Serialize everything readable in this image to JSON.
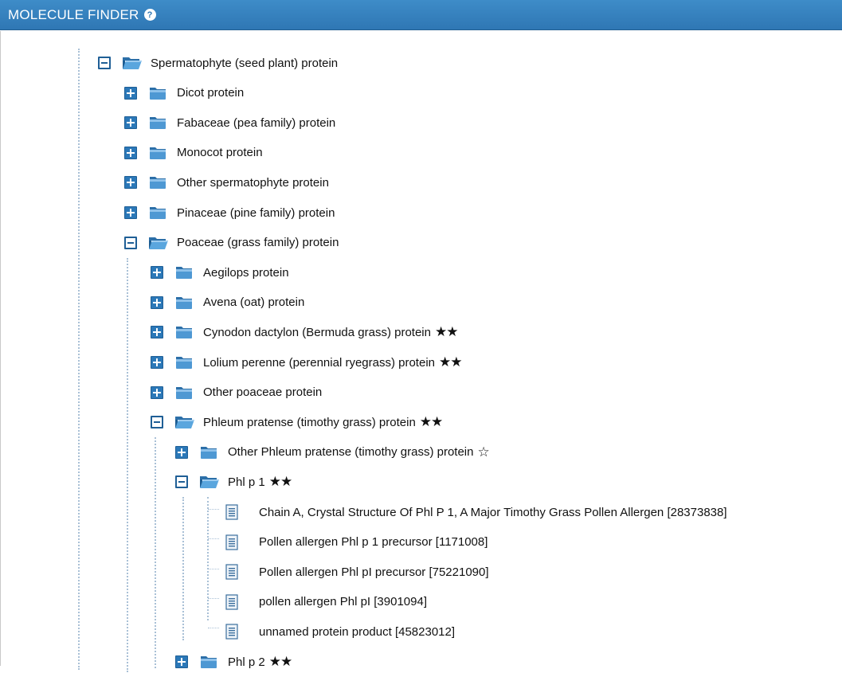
{
  "header": {
    "title": "MOLECULE FINDER",
    "help_icon": "?"
  },
  "tree": {
    "root": {
      "label": "Spermatophyte (seed plant) protein",
      "state": "expanded"
    },
    "level1": [
      {
        "label": "Dicot protein",
        "state": "collapsed"
      },
      {
        "label": "Fabaceae (pea family) protein",
        "state": "collapsed"
      },
      {
        "label": "Monocot protein",
        "state": "collapsed"
      },
      {
        "label": "Other spermatophyte protein",
        "state": "collapsed"
      },
      {
        "label": "Pinaceae (pine family) protein",
        "state": "collapsed"
      },
      {
        "label": "Poaceae (grass family) protein",
        "state": "expanded"
      }
    ],
    "poaceae_children": [
      {
        "label": "Aegilops protein",
        "stars": "",
        "state": "collapsed"
      },
      {
        "label": "Avena (oat) protein",
        "stars": "",
        "state": "collapsed"
      },
      {
        "label": "Cynodon dactylon (Bermuda grass) protein",
        "stars": "★★",
        "state": "collapsed"
      },
      {
        "label": "Lolium perenne (perennial ryegrass) protein",
        "stars": "★★",
        "state": "collapsed"
      },
      {
        "label": "Other poaceae protein",
        "stars": "",
        "state": "collapsed"
      },
      {
        "label": "Phleum pratense (timothy grass) protein",
        "stars": "★★",
        "state": "expanded"
      }
    ],
    "phleum_children": [
      {
        "label": "Other Phleum pratense (timothy grass) protein",
        "stars": "☆",
        "state": "collapsed"
      },
      {
        "label": "Phl p 1",
        "stars": "★★",
        "state": "expanded"
      },
      {
        "label": "Phl p 2",
        "stars": "★★",
        "state": "collapsed"
      }
    ],
    "phlp1_docs": [
      "Chain A, Crystal Structure Of Phl P 1, A Major Timothy Grass Pollen Allergen [28373838]",
      "Pollen allergen Phl p 1 precursor [1171008]",
      "Pollen allergen Phl pI precursor [75221090]",
      "pollen allergen Phl pI [3901094]",
      "unnamed protein product [45823012]"
    ]
  },
  "colors": {
    "header": "#2f77b4",
    "icon_blue": "#1f5f96",
    "tree_line": "#a9c0d6"
  }
}
